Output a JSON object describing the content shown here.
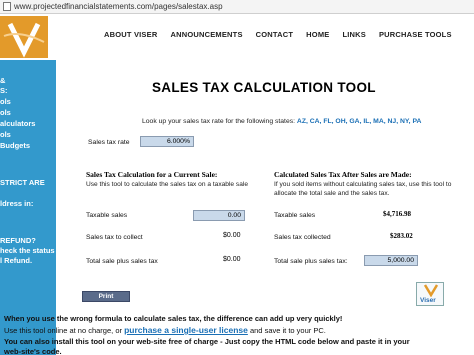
{
  "browser": {
    "url": "www.projectedfinancialstatements.com/pages/salestax.asp"
  },
  "nav": {
    "items": [
      "ABOUT VISER",
      "ANNOUNCEMENTS",
      "CONTACT",
      "HOME",
      "LINKS",
      "PURCHASE TOOLS"
    ]
  },
  "sidebar": {
    "lines": [
      "&",
      "S:",
      "ols",
      "ols",
      "alculators",
      "ols",
      "Budgets",
      "STRICT ARE",
      "ldress in:",
      "REFUND?",
      "heck the status",
      "l Refund."
    ]
  },
  "page": {
    "title": "SALES TAX CALCULATION TOOL",
    "lookup_text": "Look up your sales tax rate for the following states:",
    "states": "AZ, CA, FL, OH, GA, IL, MA, NJ, NY, PA"
  },
  "rate": {
    "label": "Sales tax rate",
    "value": "6.000%"
  },
  "left_section": {
    "heading": "Sales Tax Calculation for a Current Sale:",
    "description": "Use this tool to calculate the sales tax on a taxable sale",
    "taxable_label": "Taxable sales",
    "taxable_value": "0.00",
    "collect_label": "Sales tax to collect",
    "collect_value": "$0.00",
    "total_label": "Total sale plus sales tax",
    "total_value": "$0.00"
  },
  "right_section": {
    "heading": "Calculated Sales Tax After Sales are Made:",
    "description": "If you sold items without calculating sales tax, use this tool to allocate the total sale and the sales tax.",
    "taxable_label": "Taxable sales",
    "taxable_value": "$4,716.98",
    "collected_label": "Sales tax collected",
    "collected_value": "$283.02",
    "total_label": "Total sale plus sales tax:",
    "total_value": "5,000.00"
  },
  "actions": {
    "print_label": "Print",
    "badge_text": "Viser"
  },
  "footer": {
    "line1": "When you use the wrong formula to calculate sales tax, the difference can add up very quickly!",
    "line2_a": "Use this tool online at no charge, or",
    "line2_link": "purchase a single-user license",
    "line2_b": "and save it to your PC.",
    "line3": "You can also install this tool on your web-site free of charge - Just copy the HTML code below and paste it in your",
    "line4": "web-site's code."
  },
  "colors": {
    "sidebar": "#3399cc",
    "logo": "#e39a2a",
    "link": "#1a6fb5",
    "field": "#c9d9ea"
  }
}
